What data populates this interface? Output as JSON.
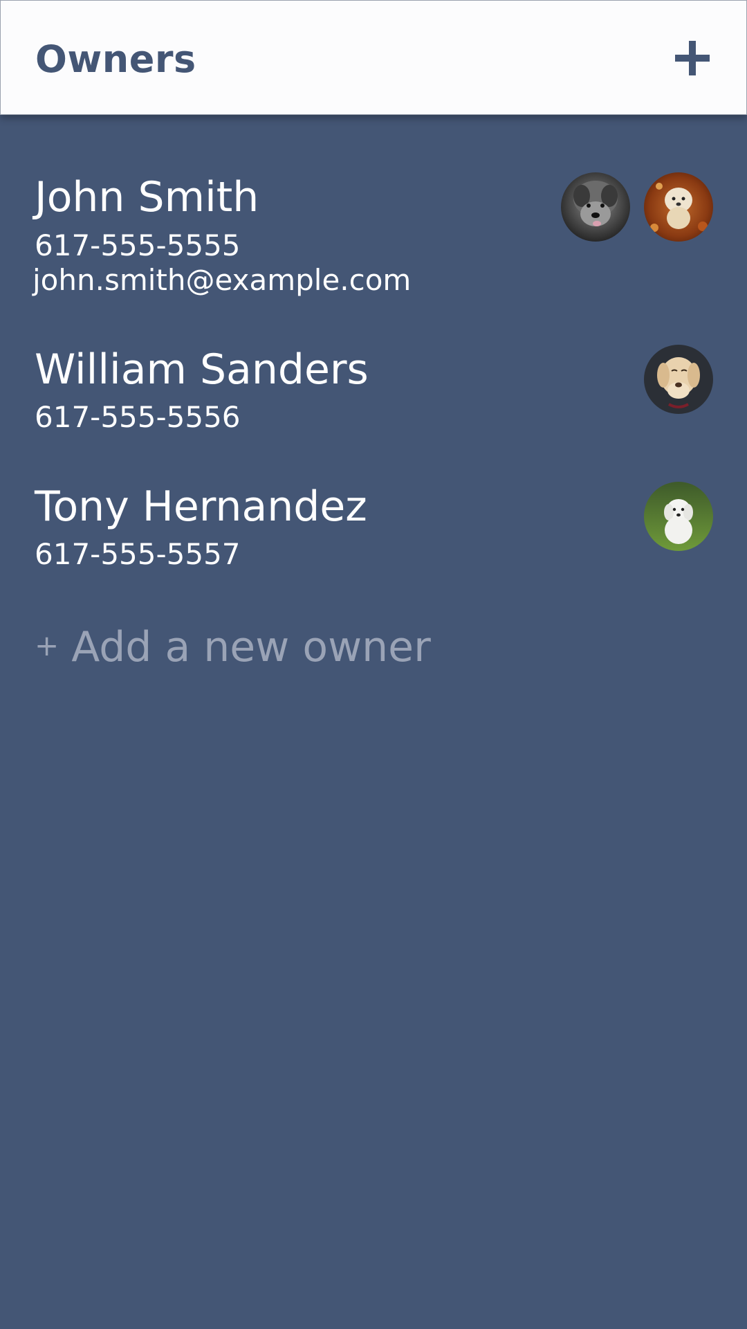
{
  "header": {
    "title": "Owners",
    "add_icon": "plus-icon",
    "accent_color": "#445675",
    "background_color": "#fcfcfd"
  },
  "theme": {
    "background": "#445675",
    "text": "#ffffff",
    "muted_text": "#9aa3b6"
  },
  "owners": [
    {
      "name": "John Smith",
      "phone": "617-555-5555",
      "email": "john.smith@example.com",
      "pets": [
        "gray-shaggy-dog-photo",
        "fluffy-dog-in-leaves-photo"
      ]
    },
    {
      "name": "William Sanders",
      "phone": "617-555-5556",
      "pets": [
        "labrador-dog-photo"
      ]
    },
    {
      "name": "Tony Hernandez",
      "phone": "617-555-5557",
      "pets": [
        "white-puppy-in-grass-photo"
      ]
    }
  ],
  "add_owner": {
    "icon": "+",
    "label": "Add a new owner"
  }
}
